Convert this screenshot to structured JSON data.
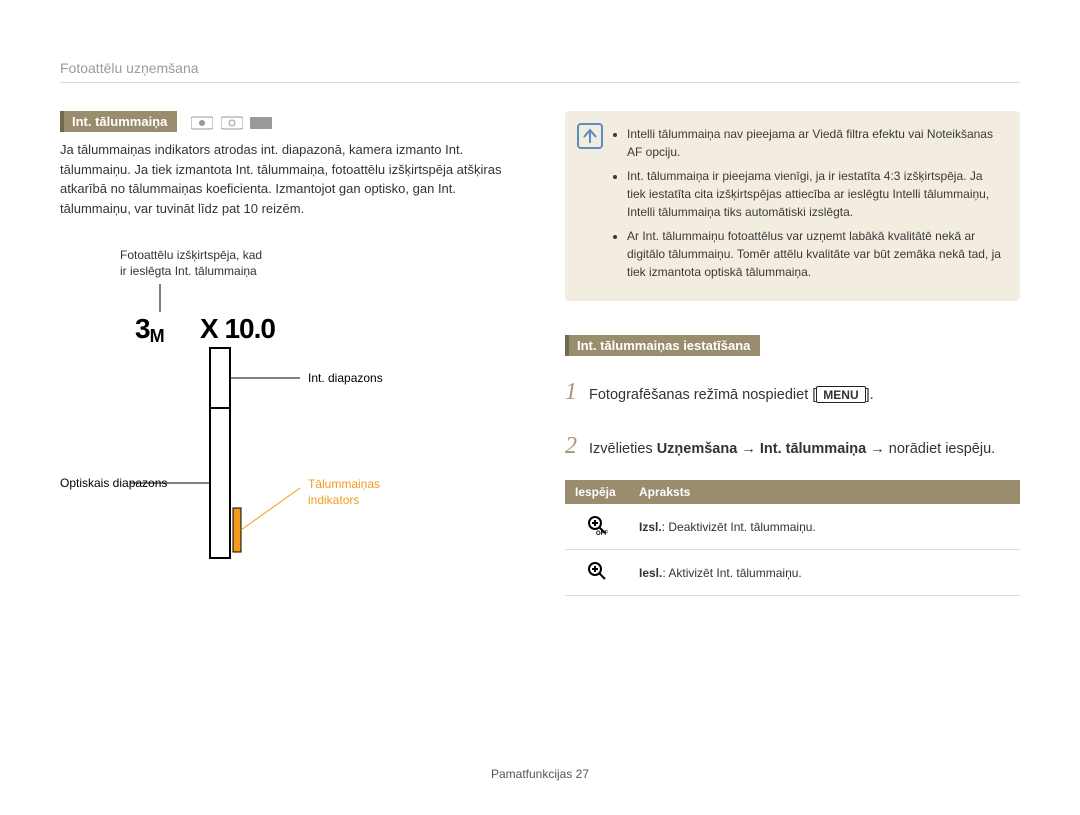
{
  "breadcrumb": "Fotoattēlu uzņemšana",
  "left": {
    "headerBadge": "Int. tālummaiņa",
    "para": "Ja tālummaiņas indikators atrodas int. diapazonā, kamera izmanto Int. tālummaiņu. Ja tiek izmantota Int. tālummaiņa, fotoattēlu izšķirtspēja atšķiras atkarībā no tālummaiņas koeficienta. Izmantojot gan optisko, gan Int. tālummaiņu, var tuvināt līdz pat 10 reizēm.",
    "photoResLabel1": "Fotoattēlu izšķirtspēja, kad",
    "photoResLabel2": "ir ieslēgta Int. tālummaiņa",
    "indicator3m": "3",
    "indicatorM": "M",
    "zoomX": "X 10.0",
    "intRange": "Int. diapazons",
    "optRange": "Optiskais diapazons",
    "zoomIndicator1": "Tālummaiņas",
    "zoomIndicator2": "indikators"
  },
  "right": {
    "notes": [
      "Intelli tālummaiņa nav pieejama ar Viedā filtra efektu vai Noteikšanas AF opciju.",
      "Int. tālummaiņa ir pieejama vienīgi, ja ir iestatīta 4:3 izšķirtspēja. Ja tiek iestatīta cita izšķirtspējas attiecība ar ieslēgtu Intelli tālummaiņu, Intelli tālummaiņa tiks automātiski izslēgta.",
      "Ar Int. tālummaiņu fotoattēlus var uzņemt labākā kvalitātē nekā ar digitālo tālummaiņu. Tomēr attēlu kvalitāte var būt zemāka nekā tad, ja tiek izmantota optiskā tālummaiņa."
    ],
    "settingsBadge": "Int. tālummaiņas iestatīšana",
    "step1": {
      "num": "1",
      "textBefore": "Fotografēšanas režīmā nospiediet [",
      "menuLabel": "MENU",
      "textAfter": "]."
    },
    "step2": {
      "num": "2",
      "pre": "Izvēlieties ",
      "b1": "Uzņemšana",
      "arrow1": " → ",
      "b2": "Int. tālummaiņa",
      "arrow2": " → norādiet iespēju."
    },
    "table": {
      "h1": "Iespēja",
      "h2": "Apraksts",
      "rows": [
        {
          "iconOff": "OFF",
          "b": "Izsl.",
          "t": ": Deaktivizēt Int. tālummaiņu."
        },
        {
          "iconOff": "",
          "b": "Iesl.",
          "t": ": Aktivizēt Int. tālummaiņu."
        }
      ]
    }
  },
  "footer": {
    "text": "Pamatfunkcijas  27"
  }
}
